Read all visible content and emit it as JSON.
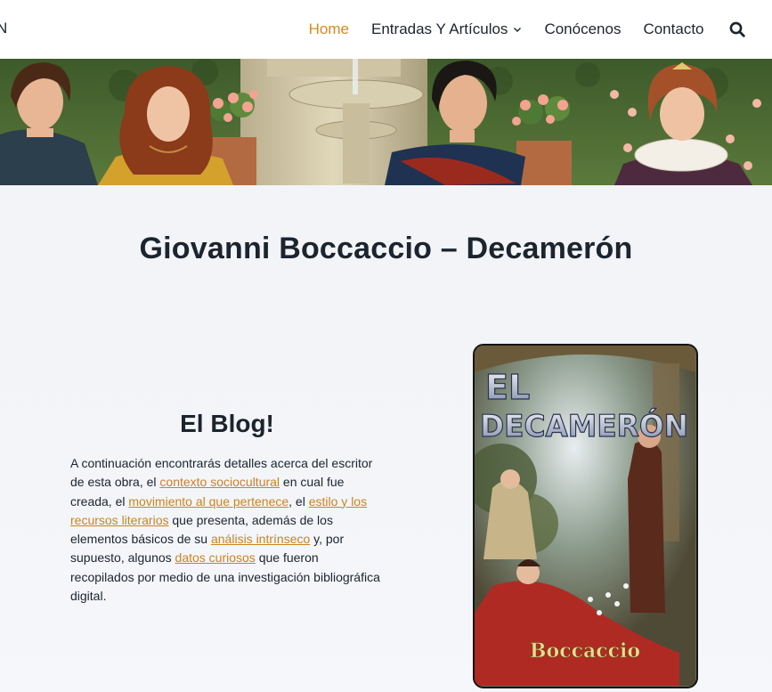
{
  "header": {
    "logo_fragment": "N",
    "nav": [
      {
        "label": "Home",
        "active": true
      },
      {
        "label": "Entradas Y Artículos",
        "dropdown": true
      },
      {
        "label": "Conócenos"
      },
      {
        "label": "Contacto"
      }
    ],
    "search_icon": "search-icon",
    "accent_color": "#d98a1d"
  },
  "page": {
    "title": "Giovanni Boccaccio – Decamerón"
  },
  "blog": {
    "title": "El Blog!",
    "t1": "A continuación encontrarás detalles acerca del escritor de esta obra, el ",
    "link1": "contexto sociocultural",
    "t2": " en cual fue creada, el ",
    "link2": "movimiento al que pertenece",
    "t3": ", el ",
    "link3": "estilo y los recursos literarios",
    "t4": " que presenta, además de los elementos básicos de su ",
    "link4": "análisis intrínseco",
    "t5": "  y, por supuesto, algunos ",
    "link5": "datos curiosos",
    "t6": " que fueron recopilados por medio de una investigación bibliográfica digital."
  },
  "book_cover": {
    "title_line1": "EL",
    "title_line2": "DECAMERÓN",
    "author": "Boccaccio"
  }
}
